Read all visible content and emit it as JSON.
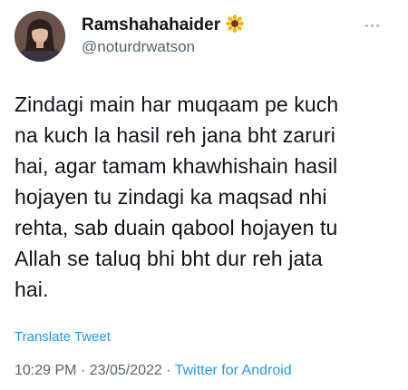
{
  "user": {
    "display_name": "Ramshahahaider",
    "handle": "@noturdrwatson",
    "emoji_icon": "sunflower-icon"
  },
  "tweet": {
    "lines": [
      "Zindagi main har muqaam pe kuch",
      "na kuch la hasil reh jana bht zaruri",
      "hai, agar tamam khawhishain hasil",
      "hojayen tu zindagi ka maqsad nhi",
      "rehta, sab duain qabool hojayen tu",
      "Allah se taluq bhi bht dur reh jata",
      "hai."
    ],
    "translate_label": "Translate Tweet"
  },
  "meta": {
    "time": "10:29 PM",
    "separator1": " · ",
    "date": "23/05/2022",
    "separator2": " · ",
    "source": "Twitter for Android"
  },
  "colors": {
    "link": "#1d9bf0",
    "secondary_text": "#536471",
    "primary_text": "#0f1419"
  }
}
